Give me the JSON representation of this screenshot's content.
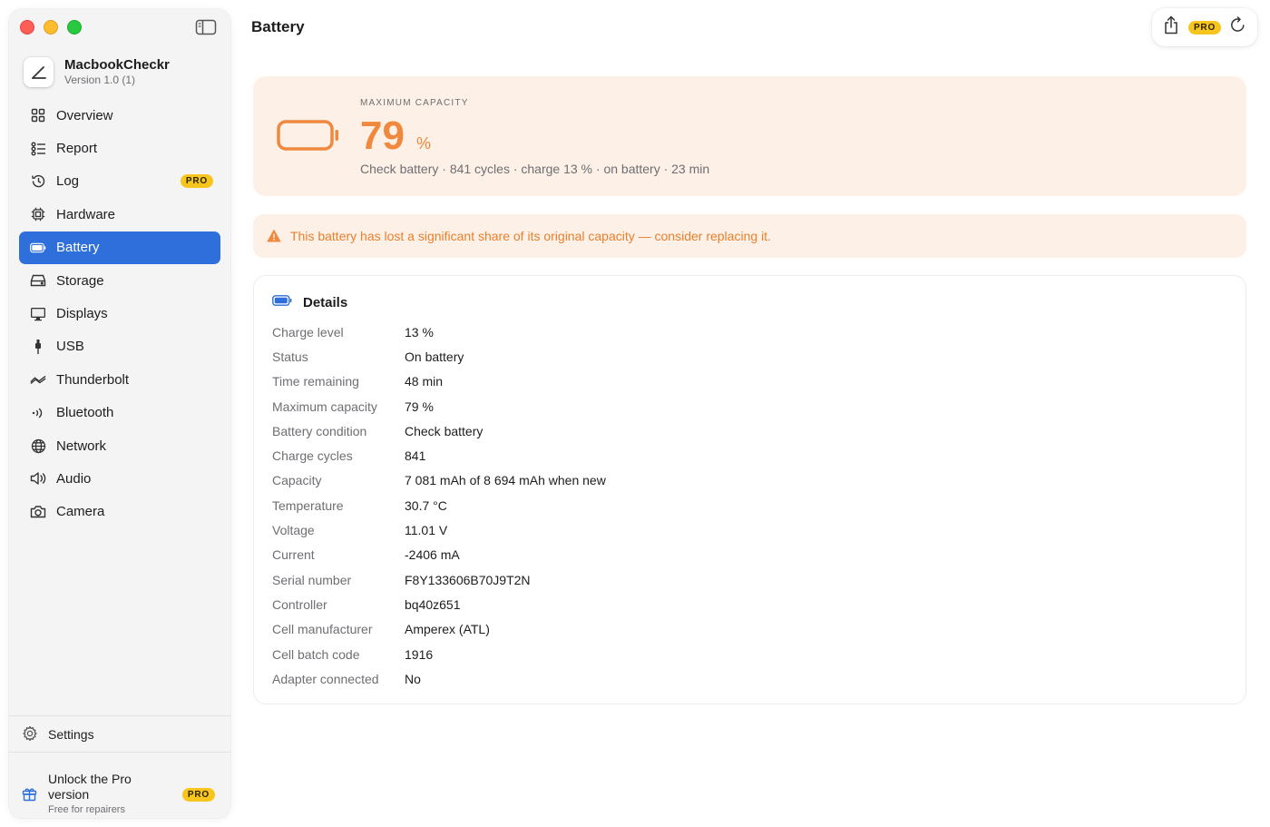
{
  "window": {
    "traffic_lights": [
      "close",
      "minimize",
      "zoom"
    ],
    "colors": {
      "close": "#ff5f57",
      "minimize": "#febc2e",
      "zoom": "#28c840"
    }
  },
  "app": {
    "name": "MacbookCheckr",
    "version": "Version 1.0 (1)"
  },
  "sidebar": {
    "items": [
      {
        "label": "Overview",
        "icon": "grid-icon"
      },
      {
        "label": "Report",
        "icon": "list-icon"
      },
      {
        "label": "Log",
        "icon": "clock-history-icon",
        "badge": "PRO"
      },
      {
        "label": "Hardware",
        "icon": "cpu-icon"
      },
      {
        "label": "Battery",
        "icon": "battery-icon",
        "active": true
      },
      {
        "label": "Storage",
        "icon": "drive-icon"
      },
      {
        "label": "Displays",
        "icon": "display-icon"
      },
      {
        "label": "USB",
        "icon": "usb-plug-icon"
      },
      {
        "label": "Thunderbolt",
        "icon": "thunderbolt-icon"
      },
      {
        "label": "Bluetooth",
        "icon": "wireless-icon"
      },
      {
        "label": "Network",
        "icon": "globe-icon"
      },
      {
        "label": "Audio",
        "icon": "speaker-icon"
      },
      {
        "label": "Camera",
        "icon": "camera-icon"
      }
    ],
    "settings_label": "Settings",
    "unlock": {
      "title": "Unlock the Pro version",
      "subtitle": "Free for repairers",
      "badge": "PRO"
    }
  },
  "header": {
    "title": "Battery",
    "pro_badge": "PRO"
  },
  "capacity": {
    "label": "MAXIMUM CAPACITY",
    "value": "79",
    "unit": "%",
    "summary": "Check battery · 841 cycles · charge 13 % · on battery · 23 min",
    "accent_color": "#f0883e"
  },
  "warning": {
    "text": "This battery has lost a significant share of its original capacity — consider replacing it.",
    "color": "#ea7f2c"
  },
  "details": {
    "title": "Details",
    "rows": [
      {
        "key": "Charge level",
        "value": "13 %"
      },
      {
        "key": "Status",
        "value": "On battery"
      },
      {
        "key": "Time remaining",
        "value": "48 min"
      },
      {
        "key": "Maximum capacity",
        "value": "79 %"
      },
      {
        "key": "Battery condition",
        "value": "Check battery"
      },
      {
        "key": "Charge cycles",
        "value": "841"
      },
      {
        "key": "Capacity",
        "value": "7 081 mAh of 8 694 mAh when new"
      },
      {
        "key": "Temperature",
        "value": "30.7 °C"
      },
      {
        "key": "Voltage",
        "value": "11.01 V"
      },
      {
        "key": "Current",
        "value": "-2406 mA"
      },
      {
        "key": "Serial number",
        "value": "F8Y133606B70J9T2N"
      },
      {
        "key": "Controller",
        "value": "bq40z651"
      },
      {
        "key": "Cell manufacturer",
        "value": "Amperex (ATL)"
      },
      {
        "key": "Cell batch code",
        "value": "1916"
      },
      {
        "key": "Adapter connected",
        "value": "No"
      }
    ]
  },
  "accent": "#2f6fdb"
}
